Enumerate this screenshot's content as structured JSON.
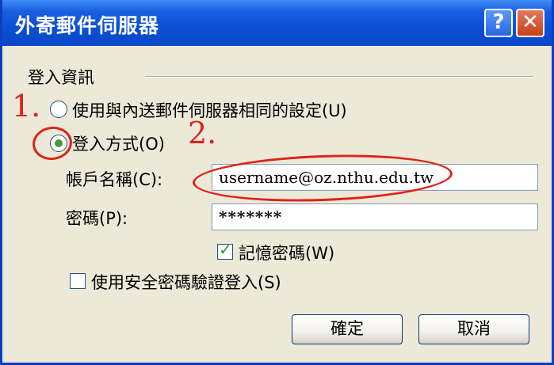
{
  "window": {
    "title": "外寄郵件伺服器",
    "help_label": "?",
    "close_label": "✕"
  },
  "group": {
    "label": "登入資訊"
  },
  "options": {
    "same_settings_label": "使用與內送郵件伺服器相同的設定(U)",
    "login_method_label": "登入方式(O)",
    "selected": "login_method"
  },
  "account": {
    "label": "帳戶名稱(C):",
    "value": "username@oz.nthu.edu.tw"
  },
  "password": {
    "label": "密碼(P):",
    "value": "*******"
  },
  "remember": {
    "label": "記憶密碼(W)",
    "checked": true
  },
  "secure_auth": {
    "label": "使用安全密碼驗證登入(S)",
    "checked": false
  },
  "buttons": {
    "ok": "確定",
    "cancel": "取消"
  },
  "annotations": {
    "step1": "1.",
    "step2": "2."
  },
  "colors": {
    "titlebar": "#0b4fd6",
    "annotation": "#e0211a",
    "dialog_bg": "#ece9d8"
  },
  "icons": {
    "help": "help-icon",
    "close": "close-icon",
    "check": "check-icon"
  }
}
